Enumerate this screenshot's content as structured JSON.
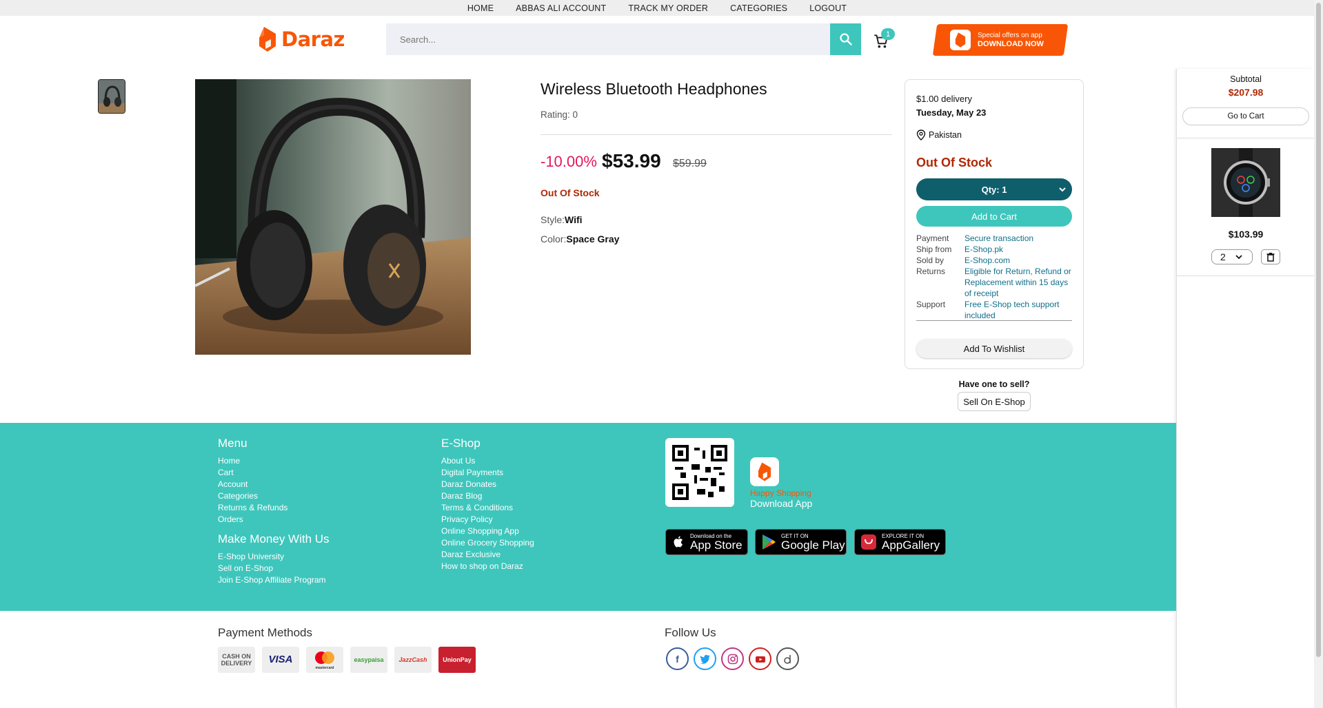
{
  "topnav": {
    "home": "HOME",
    "account": "ABBAS ALI ACCOUNT",
    "track": "TRACK MY ORDER",
    "categories": "CATEGORIES",
    "logout": "LOGOUT"
  },
  "header": {
    "logo_text": "Daraz",
    "search_placeholder": "Search...",
    "cart_count": "1",
    "banner_line1": "Special offers on app",
    "banner_line2": "DOWNLOAD NOW"
  },
  "product": {
    "title": "Wireless Bluetooth Headphones",
    "rating_label": "Rating: 0",
    "discount": "-10.00%",
    "price": "$53.99",
    "old_price": "$59.99",
    "stock": "Out Of Stock",
    "style_label": "Style:",
    "style_value": "Wifi",
    "color_label": "Color:",
    "color_value": "Space Gray"
  },
  "buybox": {
    "delivery": "$1.00 delivery",
    "delivery_date": "Tuesday, May 23",
    "location": "Pakistan",
    "stock": "Out Of Stock",
    "qty_label": "Qty: 1",
    "add_to_cart": "Add to Cart",
    "rows": [
      {
        "k": "Payment",
        "v": "Secure transaction"
      },
      {
        "k": "Ship from",
        "v": "E-Shop.pk"
      },
      {
        "k": "Sold by",
        "v": "E-Shop.com"
      },
      {
        "k": "Returns",
        "v": "Eligible for Return, Refund or Replacement within 15 days of receipt"
      },
      {
        "k": "Support",
        "v": "Free E-Shop tech support included"
      }
    ],
    "wishlist": "Add To Wishlist",
    "sell_question": "Have one to sell?",
    "sell_button": "Sell On E-Shop"
  },
  "cart_panel": {
    "subtotal_label": "Subtotal",
    "subtotal": "$207.98",
    "go_to_cart": "Go to Cart",
    "item_price": "$103.99",
    "item_qty": "2"
  },
  "footer": {
    "menu_title": "Menu",
    "menu": [
      "Home",
      "Cart",
      "Account",
      "Categories",
      "Returns & Refunds",
      "Orders"
    ],
    "money_title": "Make Money With Us",
    "money": [
      "E-Shop University",
      "Sell on E-Shop",
      "Join E-Shop Affiliate Program"
    ],
    "eshop_title": "E-Shop",
    "eshop": [
      "About Us",
      "Digital Payments",
      "Daraz Donates",
      "Daraz Blog",
      "Terms & Conditions",
      "Privacy Policy",
      "Online Shopping App",
      "Online Grocery Shopping",
      "Daraz Exclusive",
      "How to shop on Daraz"
    ],
    "happy": "Happy Shopping",
    "download_app": "Download App",
    "appstore_small": "Download on the",
    "appstore_big": "App Store",
    "gplay_small": "GET IT ON",
    "gplay_big": "Google Play",
    "appgallery_small": "EXPLORE IT ON",
    "appgallery_big": "AppGallery"
  },
  "bottom": {
    "payment_title": "Payment Methods",
    "payments": [
      "CASH ON DELIVERY",
      "VISA",
      "mastercard",
      "easypaisa",
      "JazzCash",
      "UnionPay"
    ],
    "follow_title": "Follow Us",
    "social": [
      "facebook-icon",
      "twitter-icon",
      "instagram-icon",
      "youtube-icon",
      "daraz-icon"
    ]
  },
  "colors": {
    "brand_orange": "#f85606",
    "teal": "#3ec6bc",
    "dark_teal": "#0f5e6b",
    "stock_red": "#b12704",
    "discount_pink": "#e2185b"
  }
}
